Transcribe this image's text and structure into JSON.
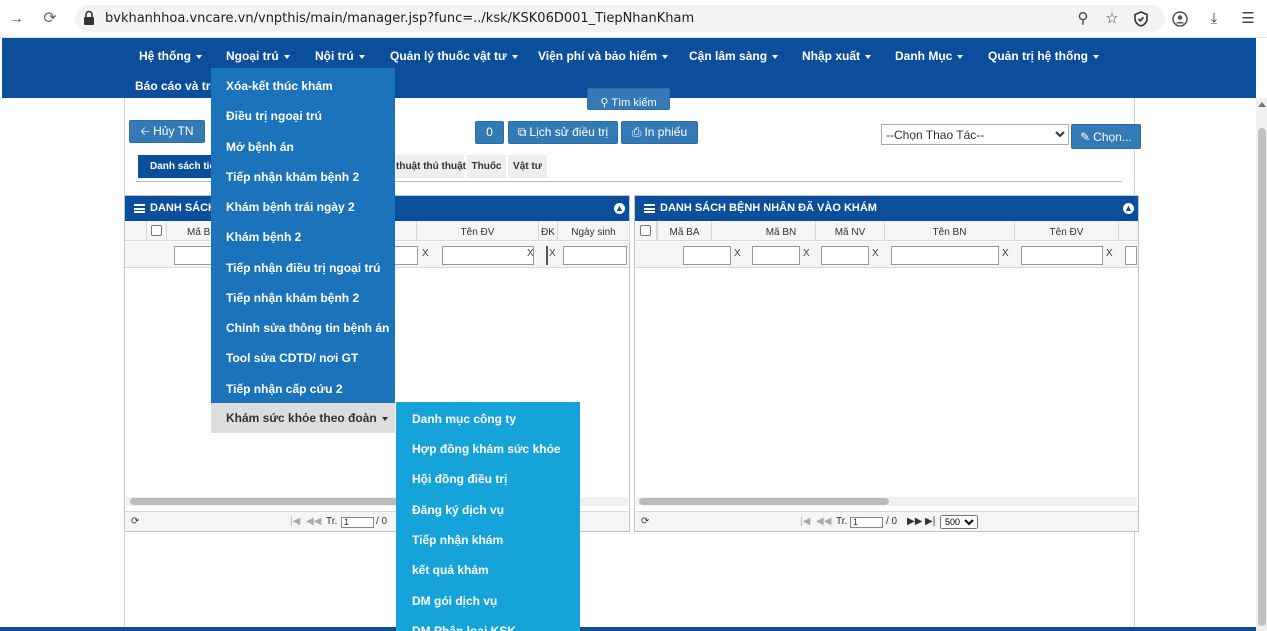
{
  "browser": {
    "url": "bvkhanhhoa.vncare.vn/vnpthis/main/manager.jsp?func=../ksk/KSK06D001_TiepNhanKham",
    "icons": [
      "back-icon",
      "reload-icon",
      "lock-icon",
      "zoom-icon",
      "star-icon",
      "shield-icon",
      "profile-icon",
      "download-icon",
      "menu-icon"
    ]
  },
  "nav": {
    "items": [
      "Hệ thống",
      "Ngoại trú",
      "Nội trú",
      "Quản lý thuốc vật tư",
      "Viện phí và bảo hiểm",
      "Cận lâm sàng",
      "Nhập xuất",
      "Danh Mục",
      "Quản trị hệ thống",
      "Báo cáo và tra"
    ],
    "background": "#0b4f9c"
  },
  "toolbar": {
    "search_label": "Tìm kiếm",
    "cancel_label": "Hủy TN",
    "count_label": "0",
    "history_label": "Lịch sử điều trị",
    "print_label": "In phiếu",
    "action_select": "--Chọn Thao Tác--",
    "choose_label": "Chọn..."
  },
  "subtabs": [
    "Danh sách tiế",
    "thuật thủ thuật",
    "Thuốc",
    "Vật tư"
  ],
  "left_panel": {
    "title": "DANH SÁCH",
    "columns": [
      "Mã B",
      "Tên ĐV",
      "ĐK",
      "Ngày sinh"
    ],
    "clear_mark": "X",
    "pager": {
      "page_prefix": "Tr.",
      "page_value": "1",
      "total": "/ 0"
    }
  },
  "right_panel": {
    "title": "DANH SÁCH BỆNH NHÂN ĐÃ VÀO KHÁM",
    "columns": [
      "Mã BA",
      "Mã BN",
      "Mã NV",
      "Tên BN",
      "Tên ĐV"
    ],
    "clear_mark": "X",
    "pager": {
      "page_prefix": "Tr.",
      "page_value": "1",
      "total": "/ 0",
      "page_size": "500"
    }
  },
  "dropdown": {
    "items": [
      "Xóa-kết thúc khám",
      "Điều trị ngoại trú",
      "Mở bệnh án",
      "Tiếp nhận khám bệnh 2",
      "Khám bệnh trái ngày 2",
      "Khám bệnh 2",
      "Tiếp nhận điều trị ngoại trú",
      "Tiếp nhận khám bệnh 2",
      "Chỉnh sửa thông tin bệnh án",
      "Tool sửa CDTD/ nơi GT",
      "Tiếp nhận cấp cứu 2",
      "Khám sức khỏe theo đoàn"
    ],
    "active_item": "Khám sức khỏe theo đoàn",
    "background": "#1b74bb"
  },
  "submenu": {
    "items": [
      "Danh mục công ty",
      "Hợp đồng khám sức khỏe",
      "Hội đồng điều trị",
      "Đăng ký dịch vụ",
      "Tiếp nhận khám",
      "kết quả khám",
      "DM gói dịch vụ",
      "DM Phân loại KSK"
    ],
    "background": "#16a3d9"
  }
}
